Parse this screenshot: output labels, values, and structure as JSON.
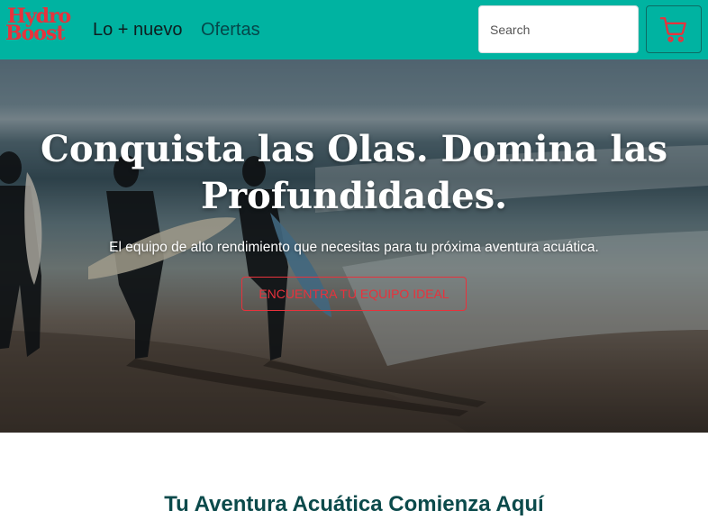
{
  "brand": {
    "line1": "Hydro",
    "line2": "Boost",
    "color": "#e8323c"
  },
  "nav": {
    "links": [
      "Lo + nuevo",
      "Ofertas"
    ],
    "background": "#00b3a1"
  },
  "search": {
    "placeholder": "Search"
  },
  "cart": {
    "icon": "cart-icon"
  },
  "hero": {
    "title": "Conquista las Olas. Domina las Profundidades.",
    "subtitle": "El equipo de alto rendimiento que necesitas para tu próxima aventura acuática.",
    "cta_label": "ENCUENTRA TU EQUIPO IDEAL",
    "image": "surfers-beach-photo"
  },
  "section": {
    "title": "Tu Aventura Acuática Comienza Aquí"
  }
}
